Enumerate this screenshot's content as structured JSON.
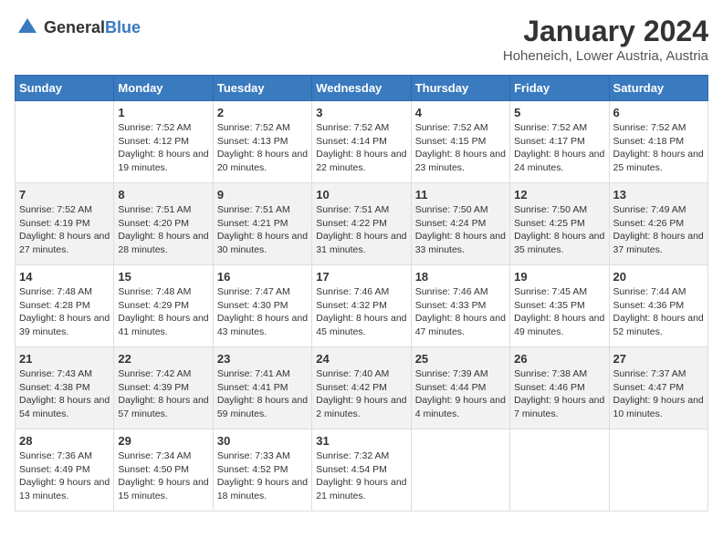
{
  "header": {
    "logo_general": "General",
    "logo_blue": "Blue",
    "title": "January 2024",
    "location": "Hoheneich, Lower Austria, Austria"
  },
  "weekdays": [
    "Sunday",
    "Monday",
    "Tuesday",
    "Wednesday",
    "Thursday",
    "Friday",
    "Saturday"
  ],
  "weeks": [
    [
      {
        "day": "",
        "sunrise": "",
        "sunset": "",
        "daylight": ""
      },
      {
        "day": "1",
        "sunrise": "Sunrise: 7:52 AM",
        "sunset": "Sunset: 4:12 PM",
        "daylight": "Daylight: 8 hours and 19 minutes."
      },
      {
        "day": "2",
        "sunrise": "Sunrise: 7:52 AM",
        "sunset": "Sunset: 4:13 PM",
        "daylight": "Daylight: 8 hours and 20 minutes."
      },
      {
        "day": "3",
        "sunrise": "Sunrise: 7:52 AM",
        "sunset": "Sunset: 4:14 PM",
        "daylight": "Daylight: 8 hours and 22 minutes."
      },
      {
        "day": "4",
        "sunrise": "Sunrise: 7:52 AM",
        "sunset": "Sunset: 4:15 PM",
        "daylight": "Daylight: 8 hours and 23 minutes."
      },
      {
        "day": "5",
        "sunrise": "Sunrise: 7:52 AM",
        "sunset": "Sunset: 4:17 PM",
        "daylight": "Daylight: 8 hours and 24 minutes."
      },
      {
        "day": "6",
        "sunrise": "Sunrise: 7:52 AM",
        "sunset": "Sunset: 4:18 PM",
        "daylight": "Daylight: 8 hours and 25 minutes."
      }
    ],
    [
      {
        "day": "7",
        "sunrise": "Sunrise: 7:52 AM",
        "sunset": "Sunset: 4:19 PM",
        "daylight": "Daylight: 8 hours and 27 minutes."
      },
      {
        "day": "8",
        "sunrise": "Sunrise: 7:51 AM",
        "sunset": "Sunset: 4:20 PM",
        "daylight": "Daylight: 8 hours and 28 minutes."
      },
      {
        "day": "9",
        "sunrise": "Sunrise: 7:51 AM",
        "sunset": "Sunset: 4:21 PM",
        "daylight": "Daylight: 8 hours and 30 minutes."
      },
      {
        "day": "10",
        "sunrise": "Sunrise: 7:51 AM",
        "sunset": "Sunset: 4:22 PM",
        "daylight": "Daylight: 8 hours and 31 minutes."
      },
      {
        "day": "11",
        "sunrise": "Sunrise: 7:50 AM",
        "sunset": "Sunset: 4:24 PM",
        "daylight": "Daylight: 8 hours and 33 minutes."
      },
      {
        "day": "12",
        "sunrise": "Sunrise: 7:50 AM",
        "sunset": "Sunset: 4:25 PM",
        "daylight": "Daylight: 8 hours and 35 minutes."
      },
      {
        "day": "13",
        "sunrise": "Sunrise: 7:49 AM",
        "sunset": "Sunset: 4:26 PM",
        "daylight": "Daylight: 8 hours and 37 minutes."
      }
    ],
    [
      {
        "day": "14",
        "sunrise": "Sunrise: 7:48 AM",
        "sunset": "Sunset: 4:28 PM",
        "daylight": "Daylight: 8 hours and 39 minutes."
      },
      {
        "day": "15",
        "sunrise": "Sunrise: 7:48 AM",
        "sunset": "Sunset: 4:29 PM",
        "daylight": "Daylight: 8 hours and 41 minutes."
      },
      {
        "day": "16",
        "sunrise": "Sunrise: 7:47 AM",
        "sunset": "Sunset: 4:30 PM",
        "daylight": "Daylight: 8 hours and 43 minutes."
      },
      {
        "day": "17",
        "sunrise": "Sunrise: 7:46 AM",
        "sunset": "Sunset: 4:32 PM",
        "daylight": "Daylight: 8 hours and 45 minutes."
      },
      {
        "day": "18",
        "sunrise": "Sunrise: 7:46 AM",
        "sunset": "Sunset: 4:33 PM",
        "daylight": "Daylight: 8 hours and 47 minutes."
      },
      {
        "day": "19",
        "sunrise": "Sunrise: 7:45 AM",
        "sunset": "Sunset: 4:35 PM",
        "daylight": "Daylight: 8 hours and 49 minutes."
      },
      {
        "day": "20",
        "sunrise": "Sunrise: 7:44 AM",
        "sunset": "Sunset: 4:36 PM",
        "daylight": "Daylight: 8 hours and 52 minutes."
      }
    ],
    [
      {
        "day": "21",
        "sunrise": "Sunrise: 7:43 AM",
        "sunset": "Sunset: 4:38 PM",
        "daylight": "Daylight: 8 hours and 54 minutes."
      },
      {
        "day": "22",
        "sunrise": "Sunrise: 7:42 AM",
        "sunset": "Sunset: 4:39 PM",
        "daylight": "Daylight: 8 hours and 57 minutes."
      },
      {
        "day": "23",
        "sunrise": "Sunrise: 7:41 AM",
        "sunset": "Sunset: 4:41 PM",
        "daylight": "Daylight: 8 hours and 59 minutes."
      },
      {
        "day": "24",
        "sunrise": "Sunrise: 7:40 AM",
        "sunset": "Sunset: 4:42 PM",
        "daylight": "Daylight: 9 hours and 2 minutes."
      },
      {
        "day": "25",
        "sunrise": "Sunrise: 7:39 AM",
        "sunset": "Sunset: 4:44 PM",
        "daylight": "Daylight: 9 hours and 4 minutes."
      },
      {
        "day": "26",
        "sunrise": "Sunrise: 7:38 AM",
        "sunset": "Sunset: 4:46 PM",
        "daylight": "Daylight: 9 hours and 7 minutes."
      },
      {
        "day": "27",
        "sunrise": "Sunrise: 7:37 AM",
        "sunset": "Sunset: 4:47 PM",
        "daylight": "Daylight: 9 hours and 10 minutes."
      }
    ],
    [
      {
        "day": "28",
        "sunrise": "Sunrise: 7:36 AM",
        "sunset": "Sunset: 4:49 PM",
        "daylight": "Daylight: 9 hours and 13 minutes."
      },
      {
        "day": "29",
        "sunrise": "Sunrise: 7:34 AM",
        "sunset": "Sunset: 4:50 PM",
        "daylight": "Daylight: 9 hours and 15 minutes."
      },
      {
        "day": "30",
        "sunrise": "Sunrise: 7:33 AM",
        "sunset": "Sunset: 4:52 PM",
        "daylight": "Daylight: 9 hours and 18 minutes."
      },
      {
        "day": "31",
        "sunrise": "Sunrise: 7:32 AM",
        "sunset": "Sunset: 4:54 PM",
        "daylight": "Daylight: 9 hours and 21 minutes."
      },
      {
        "day": "",
        "sunrise": "",
        "sunset": "",
        "daylight": ""
      },
      {
        "day": "",
        "sunrise": "",
        "sunset": "",
        "daylight": ""
      },
      {
        "day": "",
        "sunrise": "",
        "sunset": "",
        "daylight": ""
      }
    ]
  ]
}
